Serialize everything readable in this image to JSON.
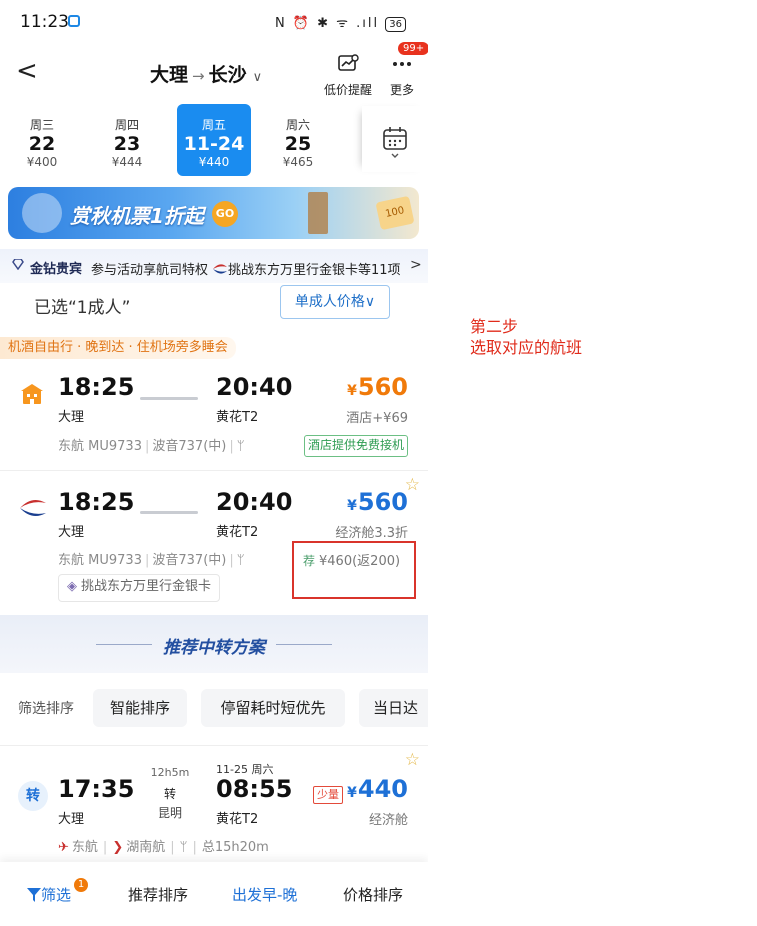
{
  "status_bar": {
    "time": "11:23",
    "icons": "N ⏰ ✱ ᯤ .ıll",
    "battery": "36"
  },
  "header": {
    "back_glyph": "<",
    "route_from": "大理",
    "route_arrow": "→",
    "route_to": "长沙",
    "route_chevron": "∨",
    "price_alert_label": "低价提醒",
    "more_label": "更多",
    "more_badge": "99+"
  },
  "dates": [
    {
      "weekday": "周三",
      "day": "22",
      "price": "¥400",
      "selected": false
    },
    {
      "weekday": "周四",
      "day": "23",
      "price": "¥444",
      "selected": false
    },
    {
      "weekday": "周五",
      "day": "11-24",
      "price": "¥440",
      "selected": true
    },
    {
      "weekday": "周六",
      "day": "25",
      "price": "¥465",
      "selected": false
    }
  ],
  "banner": {
    "text": "赏秋机票1折起",
    "go": "GO",
    "coupon": "100"
  },
  "vip": {
    "label": "金钻贵宾",
    "text1": "参与活动享航司特权",
    "text2": "挑战东方万里行金银卡等11项",
    "chevron": ">"
  },
  "filter_summary": {
    "selected": "已选“1成人”",
    "price_button": "单成人价格∨"
  },
  "promo_tag": "机酒自由行 · 晚到达 · 住机场旁多睡会",
  "flights": [
    {
      "dep_time": "18:25",
      "dep_city": "大理",
      "arr_time": "20:40",
      "arr_city": "黄花T2",
      "currency": "¥",
      "price": "560",
      "price_sub": "酒店+¥69",
      "airline": "东航",
      "flight_no": "MU9733",
      "aircraft": "波音737(中)",
      "meal_icon": "ᛘ",
      "badge": "酒店提供免费接机"
    },
    {
      "dep_time": "18:25",
      "dep_city": "大理",
      "arr_time": "20:40",
      "arr_city": "黄花T2",
      "currency": "¥",
      "price": "560",
      "price_sub": "经济舱3.3折",
      "airline": "东航",
      "flight_no": "MU9733",
      "aircraft": "波音737(中)",
      "meal_icon": "ᛘ",
      "rebate_tag": "荐",
      "rebate": "¥460(返200)",
      "card": "挑战东方万里行金银卡"
    }
  ],
  "transfer": {
    "title": "推荐中转方案"
  },
  "sort": {
    "label": "筛选排序",
    "options": [
      "智能排序",
      "停留耗时短优先",
      "当日达"
    ]
  },
  "transfer_flight": {
    "tag": "转",
    "dep_time": "17:35",
    "dep_city": "大理",
    "duration": "12h5m",
    "via": "转",
    "via_city": "昆明",
    "arr_date": "11-25 周六",
    "arr_time": "08:55",
    "arr_city": "黄花T2",
    "stock": "少量",
    "currency": "¥",
    "price": "440",
    "cabin": "经济舱",
    "airline1": "东航",
    "airline2": "湖南航",
    "total": "总15h20m"
  },
  "bottom_bar": {
    "filter": "筛选",
    "filter_badge": "1",
    "recommended": "推荐排序",
    "depart": "出发早-晚",
    "price": "价格排序"
  },
  "annotation": {
    "line1": "第二步",
    "line2": "选取对应的航班"
  },
  "colors": {
    "accent": "#1a8cf0",
    "price_blue": "#1e70d6",
    "price_orange": "#f07a0a",
    "annotation_red": "#e02b1b"
  }
}
